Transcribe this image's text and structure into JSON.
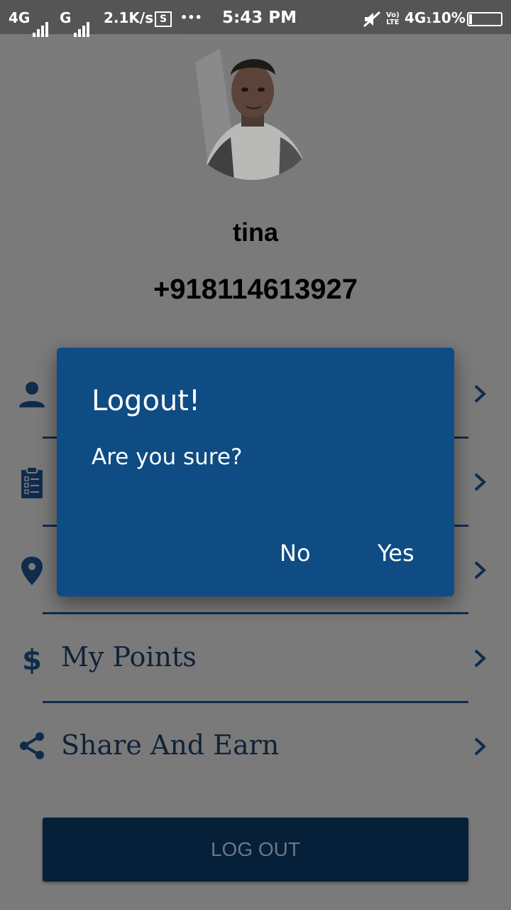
{
  "status_bar": {
    "network1": "4G",
    "network2": "G",
    "speed": "2.1K/s",
    "screenshot_icon": "S",
    "more": "•••",
    "time": "5:43 PM",
    "volte_top": "Vo)",
    "volte_bottom": "LTE",
    "network3": "4G",
    "sim_index": "1",
    "battery_percent": "10%",
    "battery_level": 0.1
  },
  "profile": {
    "name": "tina",
    "phone": "+918114613927"
  },
  "menu": {
    "items": [
      {
        "icon": "person-icon",
        "label": ""
      },
      {
        "icon": "clipboard-list-icon",
        "label": ""
      },
      {
        "icon": "location-pin-icon",
        "label": ""
      },
      {
        "icon": "dollar-icon",
        "label": "My Points"
      },
      {
        "icon": "share-icon",
        "label": "Share And Earn"
      }
    ]
  },
  "logout_button": {
    "label": "LOG OUT"
  },
  "dialog": {
    "title": "Logout!",
    "message": "Are you sure?",
    "no_label": "No",
    "yes_label": "Yes"
  },
  "colors": {
    "accent": "#0f4c84",
    "dark_navy": "#06203a",
    "icon": "#0f2c4c",
    "scrim": "#7a7a7a"
  }
}
